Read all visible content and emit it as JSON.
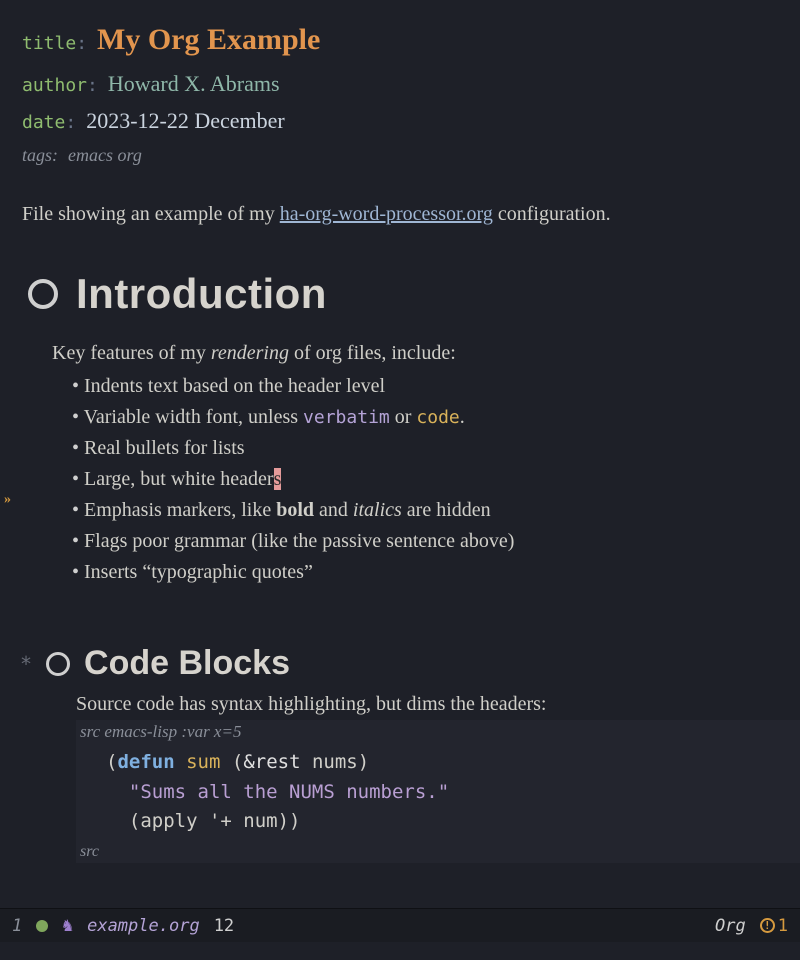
{
  "meta": {
    "title_key": "title",
    "title_val": "My Org Example",
    "author_key": "author",
    "author_val": "Howard X. Abrams",
    "date_key": "date",
    "date_val": "2023-12-22 December",
    "tags_key": "tags:",
    "tags_val": "emacs org",
    "colon": ":"
  },
  "intro": {
    "pre": "File showing an example of my ",
    "link": "ha-org-word-processor.org",
    "post": " configuration."
  },
  "sections": {
    "s1": {
      "heading": "Introduction",
      "lead_pre": "Key features of my ",
      "lead_em": "rendering",
      "lead_post": " of org files, include:",
      "b1": "Indents text based on the header level",
      "b2_pre": "Variable width font, unless ",
      "b2_verb": "verbatim",
      "b2_mid": " or ",
      "b2_code": "code",
      "b2_post": ".",
      "b3": "Real bullets for lists",
      "b4_pre": "Large, but white header",
      "b4_cur": "s",
      "b5_pre": "Emphasis markers, like ",
      "b5_bold": "bold",
      "b5_mid": " and ",
      "b5_ital": "italics",
      "b5_post": " are hidden",
      "b6": "Flags poor grammar (like the passive sentence above)",
      "b7": "Inserts “typographic quotes”"
    },
    "s2": {
      "star": "*",
      "heading": "Code Blocks",
      "lead": "Source code has syntax highlighting, but dims the headers:",
      "src_hdr_pre": "src ",
      "src_hdr_lang": "emacs-lisp :var x=5",
      "src_footer": "src",
      "code": {
        "l1a": "(",
        "l1b": "defun",
        "l1c": " ",
        "l1d": "sum",
        "l1e": " (",
        "l1f": "&rest",
        "l1g": " nums)",
        "l2": "  \"Sums all the NUMS numbers.\"",
        "l3": "  (apply '+ num))"
      }
    }
  },
  "modeline": {
    "left_num": "1",
    "unicorn": "♞",
    "filename": "example.org",
    "line": "12",
    "mode": "Org",
    "warn_sym": "!",
    "warn_count": "1"
  }
}
